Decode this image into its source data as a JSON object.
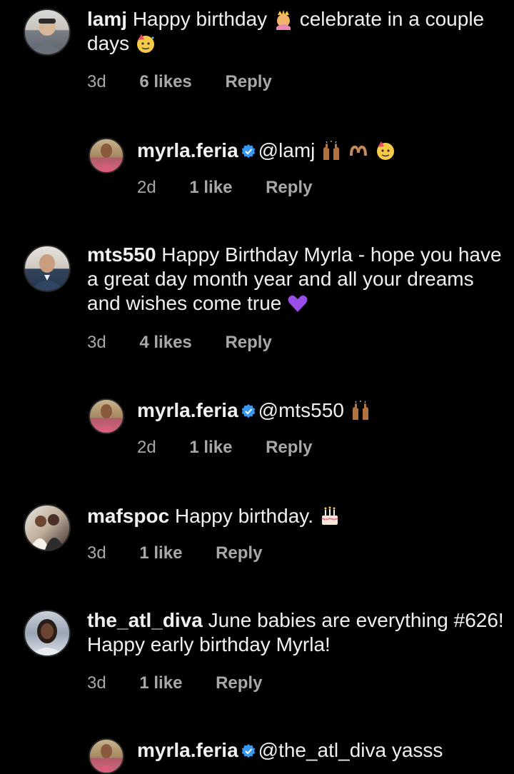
{
  "comments": [
    {
      "username": "lamj",
      "text": "Happy birthday",
      "text2": "celebrate in a couple days",
      "time": "3d",
      "likes": "6 likes",
      "reply": "Reply"
    },
    {
      "username": "myrla.feria",
      "mention": "@lamj",
      "time": "2d",
      "likes": "1 like",
      "reply": "Reply"
    },
    {
      "username": "mts550",
      "text": "Happy Birthday Myrla - hope you have a great day month year and all your dreams and wishes come true",
      "time": "3d",
      "likes": "4 likes",
      "reply": "Reply"
    },
    {
      "username": "myrla.feria",
      "mention": "@mts550",
      "time": "2d",
      "likes": "1 like",
      "reply": "Reply"
    },
    {
      "username": "mafspoc",
      "text": "Happy birthday.",
      "time": "3d",
      "likes": "1 like",
      "reply": "Reply"
    },
    {
      "username": "the_atl_diva",
      "text": "June babies are everything #626! Happy early birthday Myrla!",
      "time": "3d",
      "likes": "1 like",
      "reply": "Reply"
    },
    {
      "username": "myrla.feria",
      "mention": "@the_atl_diva yasss"
    }
  ],
  "icons": {
    "verified": "verified-badge-icon",
    "princess": "princess-emoji",
    "partying": "partying-face-emoji",
    "raised_hands": "raised-hands-emoji",
    "heart_hands": "heart-hands-emoji",
    "purple_heart": "purple-heart-emoji",
    "cake": "birthday-cake-emoji"
  },
  "colors": {
    "background": "#000000",
    "text": "#f0f0f0",
    "meta": "#a8a8a8",
    "verified": "#3897f0"
  }
}
